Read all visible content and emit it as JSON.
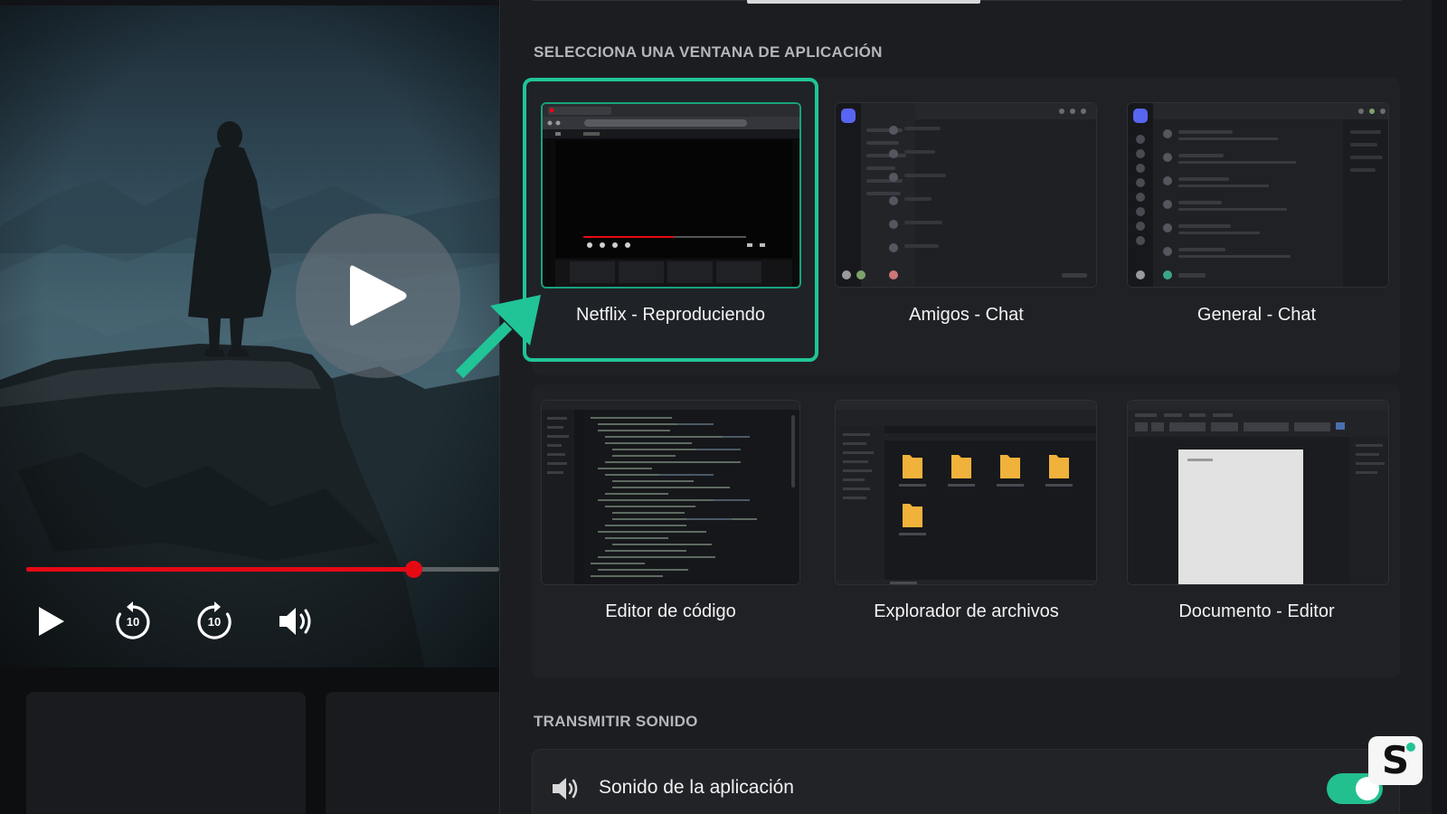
{
  "player": {
    "progress_percent": 81.8,
    "skip_back_seconds": "10",
    "skip_forward_seconds": "10",
    "accent_color": "#e50914"
  },
  "share_panel": {
    "section_windows_title": "SELECCIONA UNA VENTANA DE APLICACIÓN",
    "windows": [
      {
        "label": "Netflix - Reproduciendo",
        "selected": true,
        "thumb": "browser-video-player"
      },
      {
        "label": "Amigos - Chat",
        "selected": false,
        "thumb": "chat-app"
      },
      {
        "label": "General - Chat",
        "selected": false,
        "thumb": "chat-app"
      },
      {
        "label": "Editor de código",
        "selected": false,
        "thumb": "code-editor"
      },
      {
        "label": "Explorador de archivos",
        "selected": false,
        "thumb": "file-explorer"
      },
      {
        "label": "Documento - Editor",
        "selected": false,
        "thumb": "document-editor"
      }
    ],
    "section_sound_title": "TRANSMITIR SONIDO",
    "sound_option_label": "Sonido de la aplicación",
    "sound_enabled": true,
    "accent_color": "#21c497"
  },
  "watermark": {
    "letter": "S"
  }
}
